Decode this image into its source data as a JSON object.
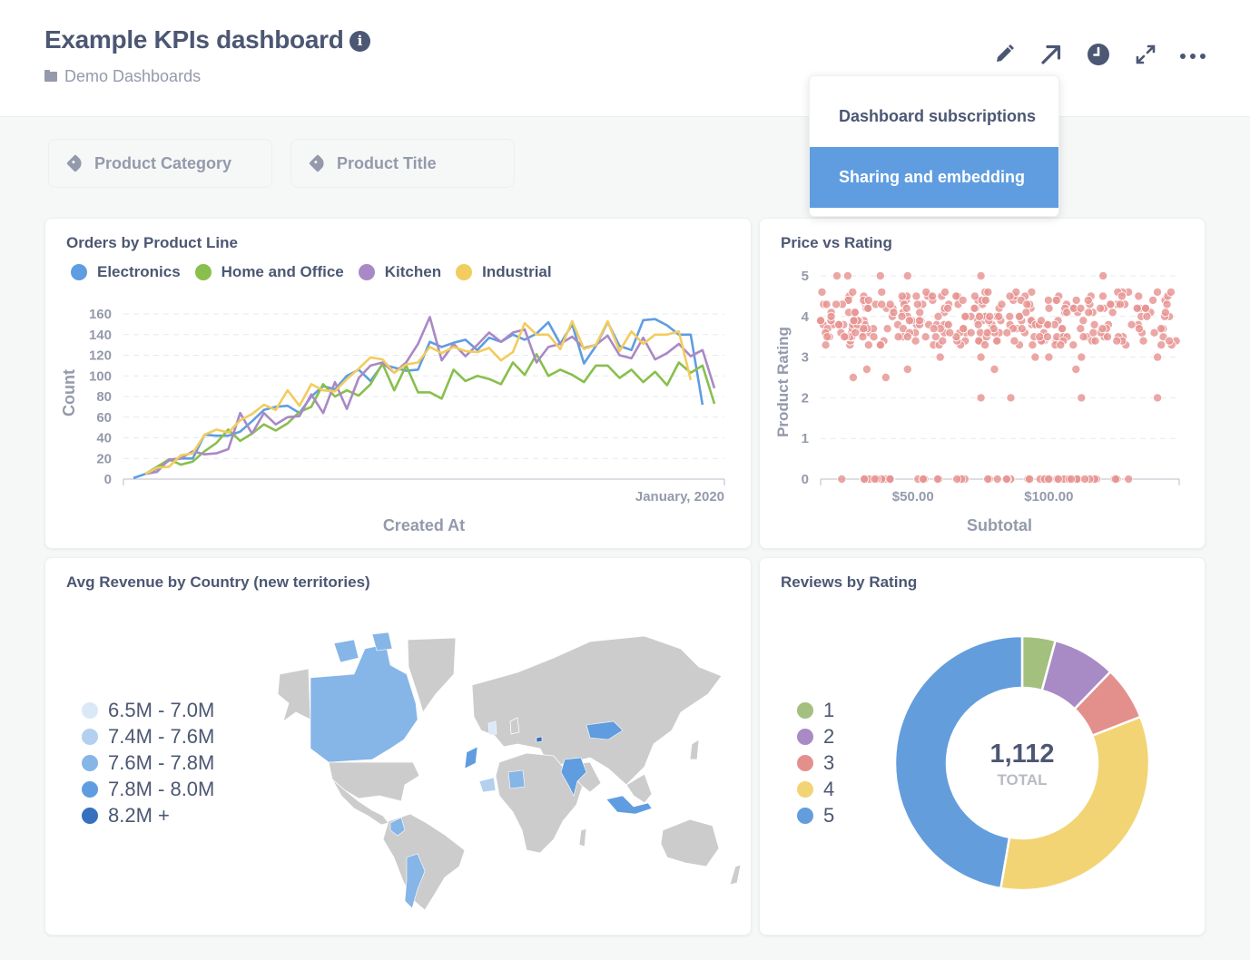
{
  "header": {
    "title": "Example KPIs dashboard",
    "collection": "Demo Dashboards",
    "icons": [
      "info-icon",
      "folder-icon",
      "pencil-icon",
      "arrow-up-right-icon",
      "clock-icon",
      "expand-icon",
      "ellipsis-icon"
    ]
  },
  "menu": {
    "items": [
      {
        "label": "Dashboard subscriptions",
        "active": false
      },
      {
        "label": "Sharing and embedding",
        "active": true
      }
    ]
  },
  "filters": [
    {
      "label": "Product Category",
      "icon": "tag-icon"
    },
    {
      "label": "Product Title",
      "icon": "tag-icon"
    }
  ],
  "colors": {
    "blue": "#5f9de0",
    "green": "#88bf4d",
    "purple": "#a989c5",
    "yellow": "#f2cc5e",
    "red": "#e69491",
    "text": "#4c5773",
    "muted": "#949aab",
    "map_gray": "#cccccc"
  },
  "chart_data": [
    {
      "type": "line",
      "title": "Orders by Product Line",
      "xlabel": "Created At",
      "ylabel": "Count",
      "ylim": [
        0,
        160
      ],
      "yticks": [
        0,
        20,
        40,
        60,
        80,
        100,
        120,
        140,
        160
      ],
      "x_tick_labels": [
        "January, 2020"
      ],
      "grid": true,
      "legend": "top-left",
      "series": [
        {
          "name": "Electronics",
          "color": "#5f9de0",
          "values": [
            1,
            5,
            10,
            18,
            20,
            20,
            43,
            42,
            42,
            46,
            56,
            67,
            70,
            71,
            64,
            80,
            90,
            87,
            100,
            106,
            95,
            111,
            108,
            105,
            106,
            133,
            128,
            132,
            135,
            125,
            137,
            133,
            140,
            135,
            141,
            152,
            131,
            150,
            112,
            129,
            152,
            129,
            125,
            154,
            155,
            149,
            140,
            140,
            72
          ]
        },
        {
          "name": "Home and Office",
          "color": "#88bf4d",
          "values": [
            null,
            5,
            12,
            19,
            14,
            17,
            27,
            35,
            48,
            37,
            44,
            53,
            47,
            54,
            65,
            70,
            92,
            80,
            86,
            81,
            92,
            112,
            86,
            110,
            84,
            84,
            78,
            106,
            95,
            100,
            97,
            92,
            113,
            101,
            121,
            100,
            106,
            101,
            94,
            110,
            110,
            98,
            106,
            94,
            104,
            91,
            113,
            103,
            110,
            73
          ]
        },
        {
          "name": "Kitchen",
          "color": "#a989c5",
          "values": [
            null,
            5,
            7,
            19,
            20,
            27,
            24,
            25,
            29,
            64,
            44,
            64,
            53,
            60,
            61,
            82,
            64,
            94,
            68,
            98,
            110,
            113,
            103,
            113,
            131,
            157,
            115,
            131,
            119,
            130,
            142,
            133,
            142,
            145,
            113,
            128,
            131,
            138,
            127,
            130,
            139,
            120,
            117,
            137,
            116,
            122,
            131,
            119,
            125,
            88
          ]
        },
        {
          "name": "Industrial",
          "color": "#f2cc5e",
          "values": [
            null,
            5,
            11,
            12,
            23,
            25,
            43,
            48,
            45,
            57,
            63,
            72,
            67,
            86,
            71,
            92,
            86,
            85,
            97,
            107,
            118,
            116,
            103,
            111,
            113,
            128,
            122,
            128,
            124,
            123,
            127,
            115,
            123,
            151,
            140,
            140,
            126,
            153,
            126,
            130,
            153,
            124,
            143,
            131,
            140,
            140,
            143,
            96
          ]
        }
      ]
    },
    {
      "type": "scatter",
      "title": "Price vs Rating",
      "xlabel": "Subtotal",
      "ylabel": "Product Rating",
      "xlim": [
        16,
        148
      ],
      "ylim": [
        0,
        5
      ],
      "xticks": [
        "$50.00",
        "$100.00"
      ],
      "yticks": [
        0,
        1,
        2,
        3,
        4,
        5
      ],
      "color": "#e69491",
      "grid": true,
      "note": "approx. 400 points; dense band 3.3-4.6, sparse ratings 2, 2.5, 5 and a row at 0"
    },
    {
      "type": "map",
      "title": "Avg Revenue by Country (new territories)",
      "legend": "left",
      "bins": [
        {
          "label": "6.5M - 7.0M",
          "color": "#dbe8f7"
        },
        {
          "label": "7.4M - 7.6M",
          "color": "#b3d0ef"
        },
        {
          "label": "7.6M - 7.8M",
          "color": "#86b5e8"
        },
        {
          "label": "7.8M - 8.0M",
          "color": "#5f9de0"
        },
        {
          "label": "8.2M +",
          "color": "#3671bf"
        }
      ],
      "highlighted_regions": [
        {
          "name": "Canada",
          "bin": 2
        },
        {
          "name": "Colombia",
          "bin": 2
        },
        {
          "name": "Argentina",
          "bin": 2
        },
        {
          "name": "Germany",
          "bin": 0
        },
        {
          "name": "Niger",
          "bin": 1
        },
        {
          "name": "Sudan",
          "bin": 2
        },
        {
          "name": "Morocco",
          "bin": 3
        },
        {
          "name": "India",
          "bin": 3
        },
        {
          "name": "Mongolia",
          "bin": 3
        },
        {
          "name": "Indonesia",
          "bin": 3
        },
        {
          "name": "Azerbaijan",
          "bin": 4
        }
      ]
    },
    {
      "type": "pie",
      "title": "Reviews by Rating",
      "legend": "left",
      "total_label": "TOTAL",
      "total": "1,112",
      "categories": [
        "1",
        "2",
        "3",
        "4",
        "5"
      ],
      "values": [
        47,
        89,
        76,
        374,
        526
      ],
      "colors": [
        "#a3c07f",
        "#a88bc4",
        "#e3908d",
        "#f2d474",
        "#639ddc"
      ]
    }
  ]
}
